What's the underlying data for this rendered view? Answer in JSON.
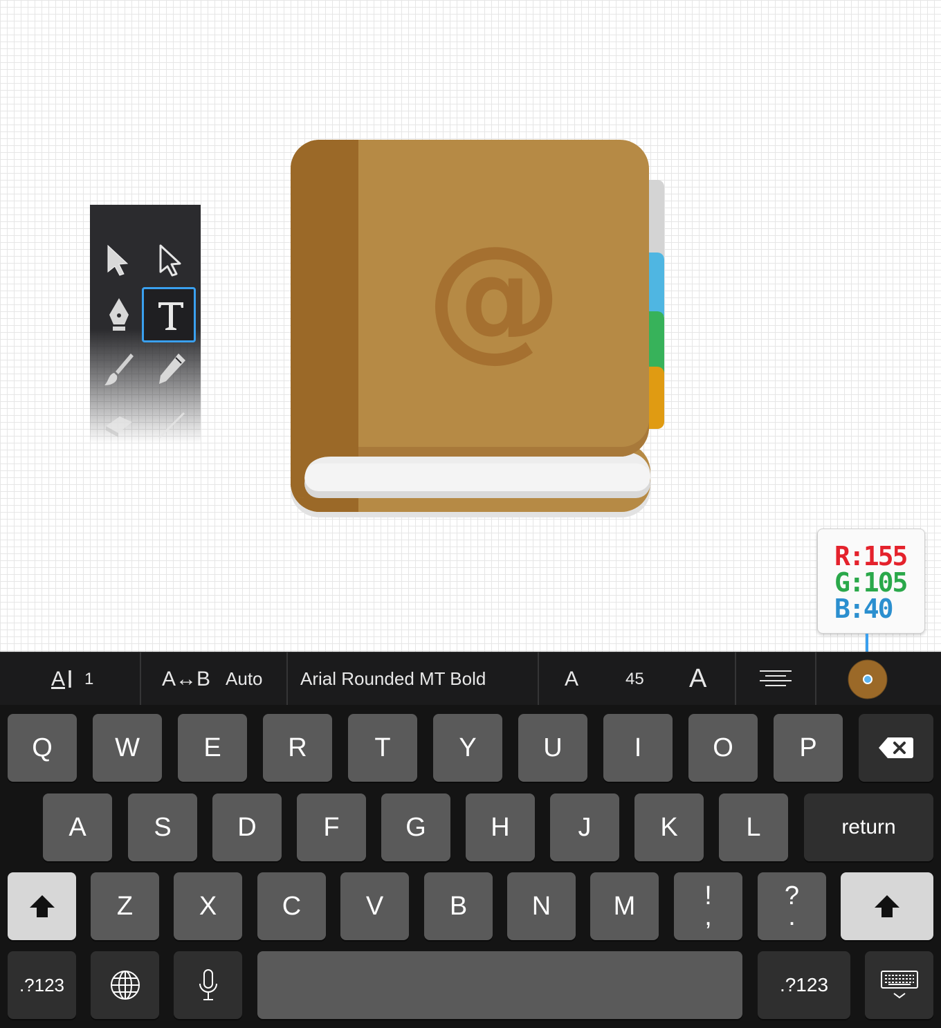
{
  "canvas": {
    "tools": [
      {
        "name": "selection-tool-icon"
      },
      {
        "name": "direct-selection-tool-icon"
      },
      {
        "name": "pen-tool-icon"
      },
      {
        "name": "type-tool-icon",
        "selected": true
      },
      {
        "name": "brush-tool-icon"
      },
      {
        "name": "pencil-tool-icon"
      },
      {
        "name": "eraser-tool-icon"
      },
      {
        "name": "line-tool-icon"
      }
    ],
    "book": {
      "symbol": "@",
      "colors": {
        "cover": "#b68a45",
        "spine": "#9b6928",
        "emboss": "#a57030",
        "tabs": [
          "#d4d4d4",
          "#4fb6e2",
          "#37b25a",
          "#e09b12"
        ]
      }
    },
    "color_readout": {
      "r": "R:155",
      "g": "G:105",
      "b": "B:40",
      "swatch_color": "#9b6928"
    }
  },
  "text_toolbar": {
    "tracking_icon_label": "A",
    "tracking_value": "1",
    "kerning_label": "A↔B",
    "kerning_value": "Auto",
    "font_name": "Arial Rounded MT Bold",
    "size_small_label": "A",
    "font_size": "45",
    "size_large_label": "A"
  },
  "keyboard": {
    "row1": [
      "Q",
      "W",
      "E",
      "R",
      "T",
      "Y",
      "U",
      "I",
      "O",
      "P"
    ],
    "row2": [
      "A",
      "S",
      "D",
      "F",
      "G",
      "H",
      "J",
      "K",
      "L"
    ],
    "return_label": "return",
    "row3": [
      "Z",
      "X",
      "C",
      "V",
      "B",
      "N",
      "M"
    ],
    "punct1": {
      "top": "!",
      "bottom": ","
    },
    "punct2": {
      "top": "?",
      "bottom": "."
    },
    "numbers_label_left": ".?123",
    "numbers_label_right": ".?123"
  }
}
